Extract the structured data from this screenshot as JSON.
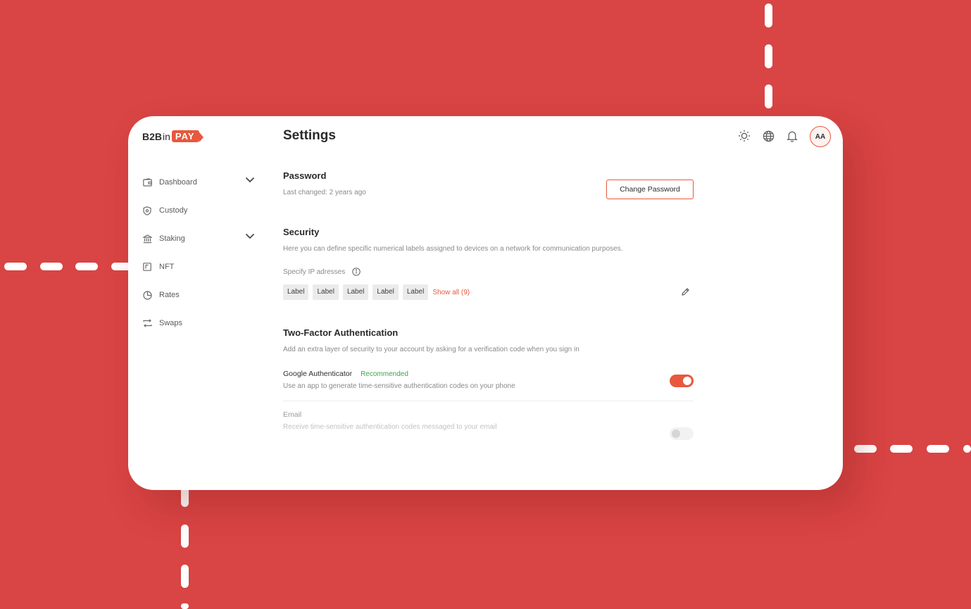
{
  "brand": {
    "logo_b2b": "B2B",
    "logo_in": "in",
    "logo_pay": "PAY",
    "accent": "#e8583d",
    "background": "#d94444"
  },
  "header": {
    "title": "Settings",
    "icons": [
      "sun-icon",
      "globe-icon",
      "bell-icon"
    ],
    "avatar_initials": "AA"
  },
  "sidebar": {
    "items": [
      {
        "label": "Dashboard",
        "icon": "wallet-icon",
        "expandable": true
      },
      {
        "label": "Custody",
        "icon": "shield-icon",
        "expandable": false
      },
      {
        "label": "Staking",
        "icon": "bank-icon",
        "expandable": true
      },
      {
        "label": "NFT",
        "icon": "nft-icon",
        "expandable": false
      },
      {
        "label": "Rates",
        "icon": "pie-chart-icon",
        "expandable": false
      },
      {
        "label": "Swaps",
        "icon": "swap-icon",
        "expandable": false
      }
    ]
  },
  "password": {
    "title": "Password",
    "last_changed": "Last changed: 2 years ago",
    "button": "Change Password"
  },
  "security": {
    "title": "Security",
    "description": "Here you can define specific numerical labels assigned to devices on a network for communication purposes.",
    "ip_label": "Specify IP adresses",
    "chips": [
      "Label",
      "Label",
      "Label",
      "Label",
      "Label"
    ],
    "show_all": "Show all (9)"
  },
  "twofa": {
    "title": "Two-Factor Authentication",
    "description": "Add an extra layer of security to your account by asking for a verification code when you sign in",
    "google": {
      "name": "Google Authenticator",
      "badge": "Recommended",
      "description": "Use an app to generate time-sensitive authentication codes on your phone",
      "enabled": true
    },
    "email": {
      "name": "Email",
      "description": "Receive time-sensitive authentication codes messaged to your email",
      "enabled": false
    }
  }
}
